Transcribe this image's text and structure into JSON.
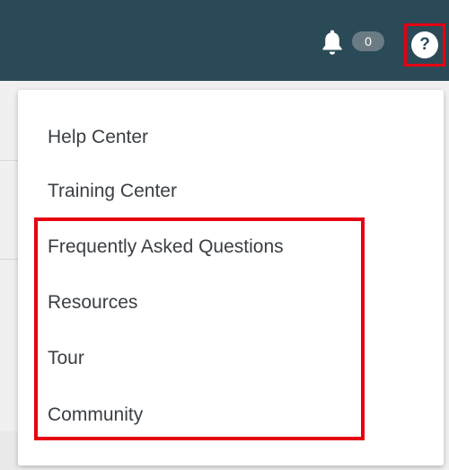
{
  "header": {
    "notification_icon": "bell-icon",
    "notification_count": "0",
    "help_icon": "question-circle-icon",
    "help_glyph": "?"
  },
  "menu": {
    "items": [
      {
        "label": "Help Center"
      },
      {
        "label": "Training Center"
      },
      {
        "label": "Frequently Asked Questions"
      },
      {
        "label": "Resources"
      },
      {
        "label": "Tour"
      },
      {
        "label": "Community"
      }
    ]
  },
  "colors": {
    "header_bg": "#2b4a58",
    "highlight": "#e60012",
    "menu_text": "#3a3f44",
    "badge_bg": "#6b7b84"
  }
}
